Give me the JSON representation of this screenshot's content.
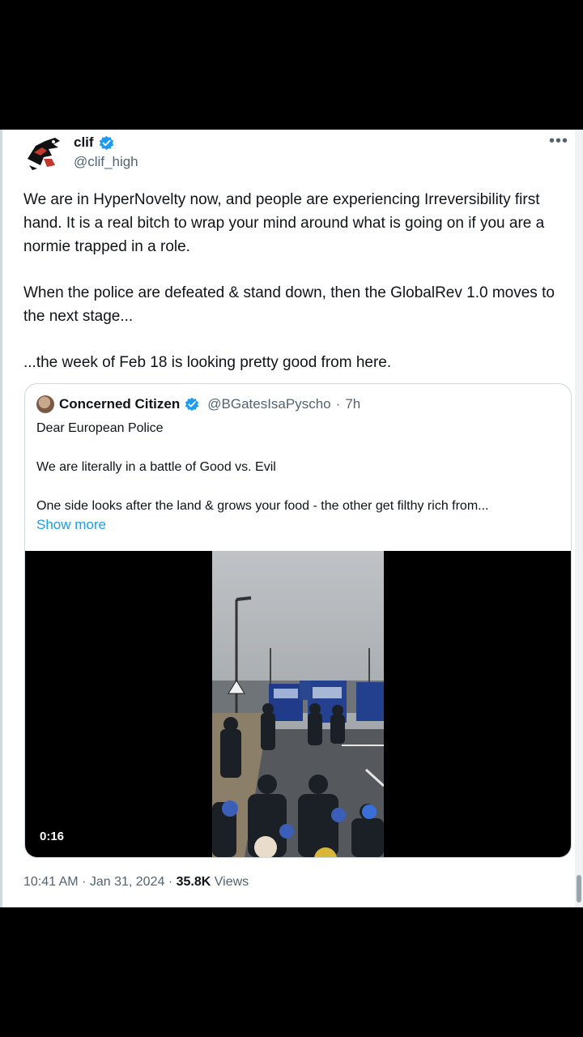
{
  "tweet": {
    "author": {
      "name": "clif",
      "handle": "@clif_high",
      "verified": true,
      "avatar_icon": "raven-logo-icon"
    },
    "more_icon": "•••",
    "paragraphs": [
      "We are in HyperNovelty now, and people are experiencing Irreversibility first hand. It is a real bitch to wrap your mind around what is going on if you are a normie trapped in a role.",
      "When the police are defeated & stand down, then the GlobalRev 1.0 moves to the next stage...",
      "...the week of Feb 18 is looking pretty good from here."
    ],
    "time": "10:41 AM",
    "date": "Jan 31, 2024",
    "separator": "·",
    "views_count": "35.8K",
    "views_label": "Views"
  },
  "quote": {
    "author": {
      "name": "Concerned Citizen",
      "handle": "@BGatesIsaPyscho",
      "separator": "·",
      "age": "7h",
      "verified": true
    },
    "lines": [
      "Dear European Police",
      "We are literally in a battle of Good vs. Evil",
      "One side looks after the land & grows your food - the other get filthy rich from..."
    ],
    "show_more": "Show more",
    "video": {
      "duration": "0:16"
    }
  },
  "colors": {
    "verified": "#1d9bf0",
    "link": "#1d9bf0",
    "secondary_text": "#536471"
  }
}
